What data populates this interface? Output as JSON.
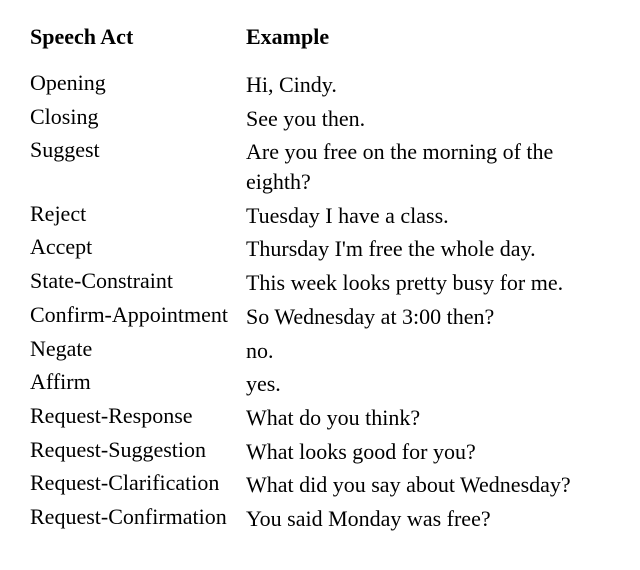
{
  "headers": {
    "col1": "Speech Act",
    "col2": "Example"
  },
  "rows": [
    {
      "act": "Opening",
      "example": "Hi, Cindy."
    },
    {
      "act": "Closing",
      "example": "See you then."
    },
    {
      "act": "Suggest",
      "example": "Are you free on the morning of the eighth?"
    },
    {
      "act": "Reject",
      "example": "Tuesday I have a class."
    },
    {
      "act": "Accept",
      "example": "Thursday I'm free the whole day."
    },
    {
      "act": "State-Constraint",
      "example": "This week looks pretty busy for me."
    },
    {
      "act": "Confirm-Appointment",
      "example": "So Wednesday at 3:00 then?"
    },
    {
      "act": "Negate",
      "example": "no."
    },
    {
      "act": "Affirm",
      "example": "yes."
    },
    {
      "act": "Request-Response",
      "example": "What do you think?"
    },
    {
      "act": "Request-Suggestion",
      "example": "What looks good for you?"
    },
    {
      "act": "Request-Clarification",
      "example": "What did you say about Wednesday?"
    },
    {
      "act": "Request-Confirmation",
      "example": "You said Monday was free?"
    }
  ]
}
